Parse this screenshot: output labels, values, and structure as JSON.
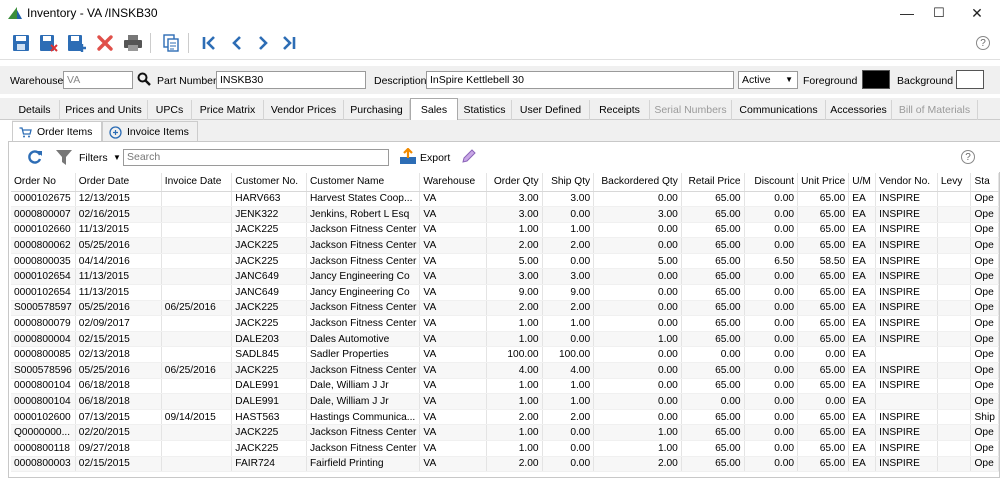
{
  "window": {
    "title": "Inventory - VA   /INSKB30",
    "minimize": "—",
    "maximize": "☐",
    "close": "✕"
  },
  "toolbar": {
    "icons": [
      "save-icon",
      "save-close-icon",
      "save-new-icon",
      "delete-icon",
      "print-icon",
      "copy-icon",
      "first-record-icon",
      "previous-record-icon",
      "next-record-icon",
      "last-record-icon"
    ],
    "help": "?"
  },
  "header": {
    "warehouse_label": "Warehouse",
    "warehouse_value": "VA",
    "part_number_label": "Part Number",
    "part_number_value": "INSKB30",
    "description_label": "Description",
    "description_value": "InSpire Kettlebell 30",
    "status_value": "Active",
    "foreground_label": "Foreground",
    "foreground_color": "#000000",
    "background_label": "Background",
    "background_color": "#ffffff"
  },
  "tabs": [
    {
      "label": "Details",
      "state": "normal"
    },
    {
      "label": "Prices and Units",
      "state": "normal"
    },
    {
      "label": "UPCs",
      "state": "normal"
    },
    {
      "label": "Price Matrix",
      "state": "normal"
    },
    {
      "label": "Vendor Prices",
      "state": "normal"
    },
    {
      "label": "Purchasing",
      "state": "normal"
    },
    {
      "label": "Sales",
      "state": "active"
    },
    {
      "label": "Statistics",
      "state": "normal"
    },
    {
      "label": "User Defined",
      "state": "normal"
    },
    {
      "label": "Receipts",
      "state": "normal"
    },
    {
      "label": "Serial Numbers",
      "state": "disabled"
    },
    {
      "label": "Communications",
      "state": "normal"
    },
    {
      "label": "Accessories",
      "state": "normal"
    },
    {
      "label": "Bill of Materials",
      "state": "disabled"
    }
  ],
  "subtabs": [
    {
      "label": "Order Items",
      "icon": "cart-icon",
      "state": "active"
    },
    {
      "label": "Invoice Items",
      "icon": "invoice-icon",
      "state": "normal"
    }
  ],
  "grid_toolbar": {
    "filters_label": "Filters",
    "search_placeholder": "Search",
    "export_label": "Export",
    "help": "?"
  },
  "table": {
    "columns": [
      "Order No",
      "Order Date",
      "Invoice Date",
      "Customer No.",
      "Customer Name",
      "Warehouse",
      "Order Qty",
      "Ship Qty",
      "Backordered Qty",
      "Retail Price",
      "Discount",
      "Unit Price",
      "U/M",
      "Vendor No.",
      "Levy",
      "Sta"
    ],
    "rows": [
      [
        "0000102675",
        "12/13/2015",
        "",
        "HARV663",
        "Harvest States Coop...",
        "VA",
        "3.00",
        "3.00",
        "0.00",
        "65.00",
        "0.00",
        "65.00",
        "EA",
        "INSPIRE",
        "",
        "Ope"
      ],
      [
        "0000800007",
        "02/16/2015",
        "",
        "JENK322",
        "Jenkins, Robert L Esq",
        "VA",
        "3.00",
        "0.00",
        "3.00",
        "65.00",
        "0.00",
        "65.00",
        "EA",
        "INSPIRE",
        "",
        "Ope"
      ],
      [
        "0000102660",
        "11/13/2015",
        "",
        "JACK225",
        "Jackson Fitness Center",
        "VA",
        "1.00",
        "1.00",
        "0.00",
        "65.00",
        "0.00",
        "65.00",
        "EA",
        "INSPIRE",
        "",
        "Ope"
      ],
      [
        "0000800062",
        "05/25/2016",
        "",
        "JACK225",
        "Jackson Fitness Center",
        "VA",
        "2.00",
        "2.00",
        "0.00",
        "65.00",
        "0.00",
        "65.00",
        "EA",
        "INSPIRE",
        "",
        "Ope"
      ],
      [
        "0000800035",
        "04/14/2016",
        "",
        "JACK225",
        "Jackson Fitness Center",
        "VA",
        "5.00",
        "0.00",
        "5.00",
        "65.00",
        "6.50",
        "58.50",
        "EA",
        "INSPIRE",
        "",
        "Ope"
      ],
      [
        "0000102654",
        "11/13/2015",
        "",
        "JANC649",
        "Jancy Engineering Co",
        "VA",
        "3.00",
        "3.00",
        "0.00",
        "65.00",
        "0.00",
        "65.00",
        "EA",
        "INSPIRE",
        "",
        "Ope"
      ],
      [
        "0000102654",
        "11/13/2015",
        "",
        "JANC649",
        "Jancy Engineering Co",
        "VA",
        "9.00",
        "9.00",
        "0.00",
        "65.00",
        "0.00",
        "65.00",
        "EA",
        "INSPIRE",
        "",
        "Ope"
      ],
      [
        "S000578597",
        "05/25/2016",
        "06/25/2016",
        "JACK225",
        "Jackson Fitness Center",
        "VA",
        "2.00",
        "2.00",
        "0.00",
        "65.00",
        "0.00",
        "65.00",
        "EA",
        "INSPIRE",
        "",
        "Ope"
      ],
      [
        "0000800079",
        "02/09/2017",
        "",
        "JACK225",
        "Jackson Fitness Center",
        "VA",
        "1.00",
        "1.00",
        "0.00",
        "65.00",
        "0.00",
        "65.00",
        "EA",
        "INSPIRE",
        "",
        "Ope"
      ],
      [
        "0000800004",
        "02/15/2015",
        "",
        "DALE203",
        "Dales Automotive",
        "VA",
        "1.00",
        "0.00",
        "1.00",
        "65.00",
        "0.00",
        "65.00",
        "EA",
        "INSPIRE",
        "",
        "Ope"
      ],
      [
        "0000800085",
        "02/13/2018",
        "",
        "SADL845",
        "Sadler Properties",
        "VA",
        "100.00",
        "100.00",
        "0.00",
        "0.00",
        "0.00",
        "0.00",
        "EA",
        "",
        "",
        "Ope"
      ],
      [
        "S000578596",
        "05/25/2016",
        "06/25/2016",
        "JACK225",
        "Jackson Fitness Center",
        "VA",
        "4.00",
        "4.00",
        "0.00",
        "65.00",
        "0.00",
        "65.00",
        "EA",
        "INSPIRE",
        "",
        "Ope"
      ],
      [
        "0000800104",
        "06/18/2018",
        "",
        "DALE991",
        "Dale, William J Jr",
        "VA",
        "1.00",
        "1.00",
        "0.00",
        "65.00",
        "0.00",
        "65.00",
        "EA",
        "INSPIRE",
        "",
        "Ope"
      ],
      [
        "0000800104",
        "06/18/2018",
        "",
        "DALE991",
        "Dale, William J Jr",
        "VA",
        "1.00",
        "1.00",
        "0.00",
        "0.00",
        "0.00",
        "0.00",
        "EA",
        "",
        "",
        "Ope"
      ],
      [
        "0000102600",
        "07/13/2015",
        "09/14/2015",
        "HAST563",
        "Hastings Communica...",
        "VA",
        "2.00",
        "2.00",
        "0.00",
        "65.00",
        "0.00",
        "65.00",
        "EA",
        "INSPIRE",
        "",
        "Ship"
      ],
      [
        "Q0000000...",
        "02/20/2015",
        "",
        "JACK225",
        "Jackson Fitness Center",
        "VA",
        "1.00",
        "0.00",
        "1.00",
        "65.00",
        "0.00",
        "65.00",
        "EA",
        "INSPIRE",
        "",
        "Ope"
      ],
      [
        "0000800118",
        "09/27/2018",
        "",
        "JACK225",
        "Jackson Fitness Center",
        "VA",
        "1.00",
        "0.00",
        "1.00",
        "65.00",
        "0.00",
        "65.00",
        "EA",
        "INSPIRE",
        "",
        "Ope"
      ],
      [
        "0000800003",
        "02/15/2015",
        "",
        "FAIR724",
        "Fairfield Printing",
        "VA",
        "2.00",
        "0.00",
        "2.00",
        "65.00",
        "0.00",
        "65.00",
        "EA",
        "INSPIRE",
        "",
        "Ope"
      ]
    ]
  }
}
